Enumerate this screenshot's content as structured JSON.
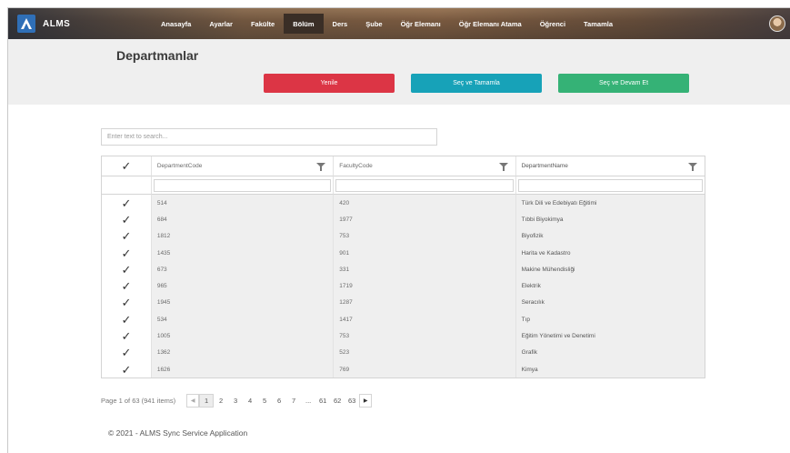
{
  "brand": {
    "name": "ALMS",
    "logo_icon": "alms-logo-icon"
  },
  "nav": [
    {
      "label": "Anasayfa",
      "active": false
    },
    {
      "label": "Ayarlar",
      "active": false
    },
    {
      "label": "Fakülte",
      "active": false
    },
    {
      "label": "Bölüm",
      "active": true
    },
    {
      "label": "Ders",
      "active": false
    },
    {
      "label": "Şube",
      "active": false
    },
    {
      "label": "Öğr Elemanı",
      "active": false
    },
    {
      "label": "Öğr Elemanı Atama",
      "active": false
    },
    {
      "label": "Öğrenci",
      "active": false
    },
    {
      "label": "Tamamla",
      "active": false
    }
  ],
  "page": {
    "title": "Departmanlar"
  },
  "actions": {
    "refresh": "Yenile",
    "select_complete": "Seç ve Tamamla",
    "select_continue": "Seç ve Devam Et"
  },
  "colors": {
    "red": "#dc3545",
    "teal": "#17a2b8",
    "green": "#35b276"
  },
  "search": {
    "placeholder": "Enter text to search..."
  },
  "grid": {
    "columns": [
      "DepartmentCode",
      "FacultyCode",
      "DepartmentName"
    ],
    "rows": [
      {
        "code": "514",
        "faculty": "420",
        "name": "Türk Dili ve Edebiyatı Eğitimi"
      },
      {
        "code": "684",
        "faculty": "1977",
        "name": "Tıbbi Biyokimya"
      },
      {
        "code": "1812",
        "faculty": "753",
        "name": "Biyofizik"
      },
      {
        "code": "1435",
        "faculty": "901",
        "name": "Harita ve Kadastro"
      },
      {
        "code": "673",
        "faculty": "331",
        "name": "Makine Mühendisliği"
      },
      {
        "code": "965",
        "faculty": "1719",
        "name": "Elektrik"
      },
      {
        "code": "1945",
        "faculty": "1287",
        "name": "Seracılık"
      },
      {
        "code": "534",
        "faculty": "1417",
        "name": "Tıp"
      },
      {
        "code": "1005",
        "faculty": "753",
        "name": "Eğitim Yönetimi ve Denetimi"
      },
      {
        "code": "1362",
        "faculty": "523",
        "name": "Grafik"
      },
      {
        "code": "1626",
        "faculty": "769",
        "name": "Kimya"
      }
    ]
  },
  "pager": {
    "summary": "Page 1 of 63 (941 items)",
    "pages": [
      "1",
      "2",
      "3",
      "4",
      "5",
      "6",
      "7",
      "...",
      "61",
      "62",
      "63"
    ],
    "current": "1"
  },
  "footer": {
    "text": "© 2021 - ALMS Sync Service Application"
  }
}
